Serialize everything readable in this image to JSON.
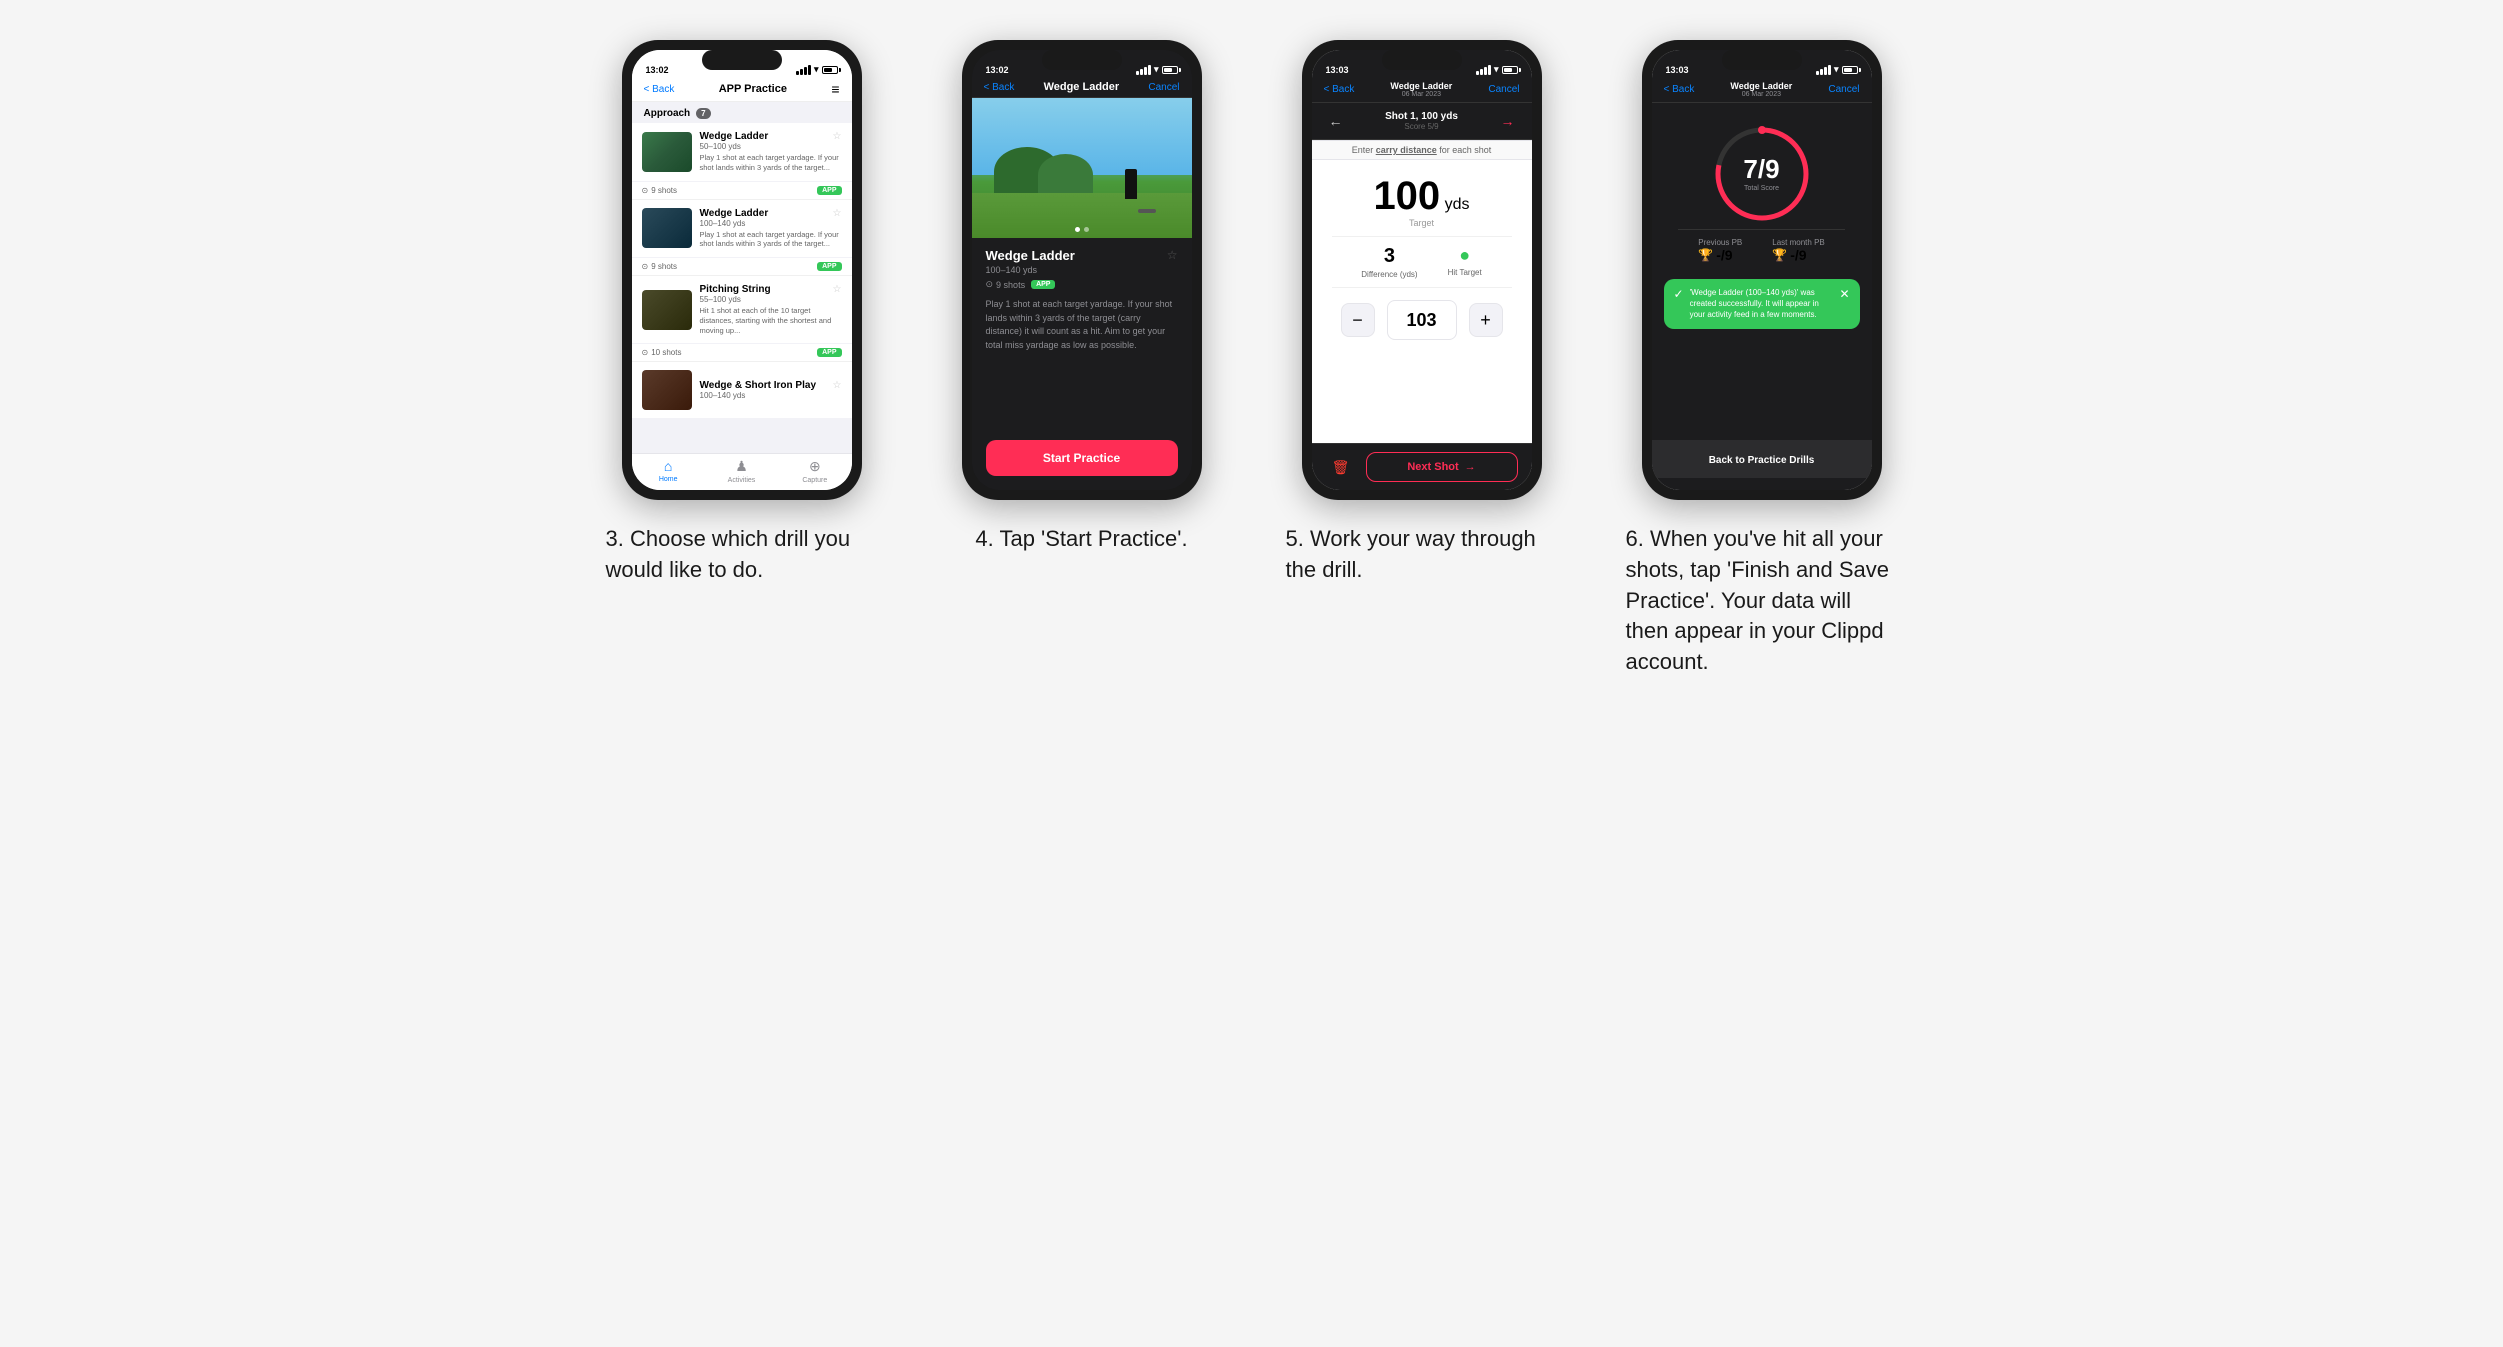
{
  "steps": [
    {
      "id": "step3",
      "number": "3.",
      "caption": "Choose which drill you would like to do.",
      "phone": {
        "time": "13:02",
        "navBack": "< Back",
        "navTitle": "APP Practice",
        "navMenu": "≡",
        "sectionLabel": "Approach",
        "sectionCount": "7",
        "drills": [
          {
            "name": "Wedge Ladder",
            "range": "50–100 yds",
            "desc": "Play 1 shot at each target yardage. If your shot lands within 3 yards of the target...",
            "shots": "9 shots",
            "badge": "APP"
          },
          {
            "name": "Wedge Ladder",
            "range": "100–140 yds",
            "desc": "Play 1 shot at each target yardage. If your shot lands within 3 yards of the target...",
            "shots": "9 shots",
            "badge": "APP"
          },
          {
            "name": "Pitching String",
            "range": "55–100 yds",
            "desc": "Hit 1 shot at each of the 10 target distances, starting with the shortest and moving up...",
            "shots": "10 shots",
            "badge": "APP"
          },
          {
            "name": "Wedge & Short Iron Play",
            "range": "100–140 yds",
            "desc": "",
            "shots": "",
            "badge": ""
          }
        ],
        "tabs": [
          "Home",
          "Activities",
          "Capture"
        ]
      }
    },
    {
      "id": "step4",
      "number": "4.",
      "caption": "Tap 'Start Practice'.",
      "phone": {
        "time": "13:02",
        "navBack": "< Back",
        "navTitle": "Wedge Ladder",
        "navCancel": "Cancel",
        "drillName": "Wedge Ladder",
        "drillRange": "100–140 yds",
        "drillShots": "9 shots",
        "drillBadge": "APP",
        "drillDesc": "Play 1 shot at each target yardage. If your shot lands within 3 yards of the target (carry distance) it will count as a hit. Aim to get your total miss yardage as low as possible.",
        "startBtn": "Start Practice"
      }
    },
    {
      "id": "step5",
      "number": "5.",
      "caption": "Work your way through the drill.",
      "phone": {
        "time": "13:03",
        "navBack": "< Back",
        "navTitle": "Wedge Ladder\n06 Mar 2023",
        "navCancel": "Cancel",
        "shotNumber": "Shot 1, 100 yds",
        "score": "Score 5/9",
        "instruction": "Enter carry distance for each shot",
        "targetValue": "100",
        "targetUnit": "yds",
        "targetLabel": "Target",
        "differenceValue": "3",
        "differenceLabel": "Difference (yds)",
        "hitTargetLabel": "Hit Target",
        "inputValue": "103",
        "nextBtn": "Next Shot"
      }
    },
    {
      "id": "step6",
      "number": "6.",
      "caption": "When you've hit all your shots, tap 'Finish and Save Practice'. Your data will then appear in your Clippd account.",
      "phone": {
        "time": "13:03",
        "navBack": "< Back",
        "navTitle": "Wedge Ladder\n06 Mar 2023",
        "navCancel": "Cancel",
        "scoreNumerator": "7",
        "scoreDenominator": "/9",
        "totalScoreLabel": "Total Score",
        "previousPBLabel": "Previous PB",
        "previousPBValue": "-/9",
        "lastMonthPBLabel": "Last month PB",
        "lastMonthPBValue": "-/9",
        "toastText": "'Wedge Ladder (100–140 yds)' was created successfully. It will appear in your activity feed in a few moments.",
        "backBtn": "Back to Practice Drills"
      }
    }
  ]
}
